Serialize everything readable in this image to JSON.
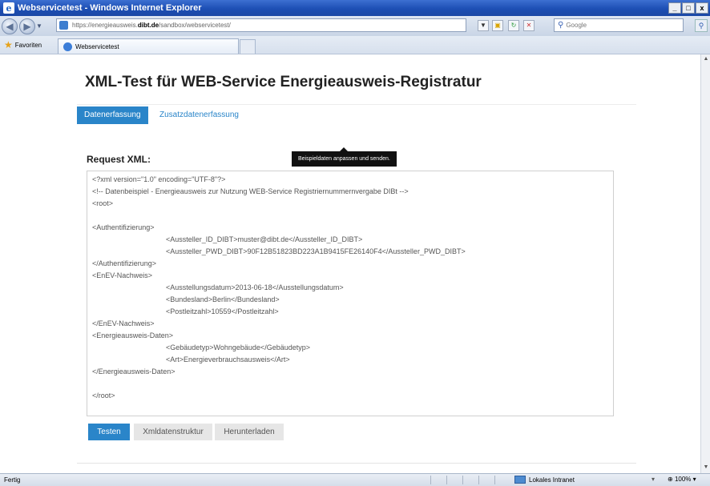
{
  "window": {
    "title": "Webservicetest - Windows Internet Explorer",
    "minimize": "_",
    "maximize": "□",
    "close": "x"
  },
  "address_bar": {
    "url_prefix": "https://energieausweis.",
    "url_domain": "dibt.de",
    "url_path": "/sandbox/webservicetest/",
    "search_placeholder": "Google"
  },
  "favorites_bar": {
    "label": "Favoriten",
    "tab_title": "Webservicetest"
  },
  "page": {
    "title": "XML-Test für WEB-Service Energieausweis-Registratur",
    "tabs": [
      {
        "label": "Datenerfassung",
        "active": true
      },
      {
        "label": "Zusatzdatenerfassung",
        "active": false
      }
    ],
    "request_label": "Request XML:",
    "tooltip": "Beispieldaten anpassen und senden.",
    "xml_lines": [
      "<?xml version=\"1.0\" encoding=\"UTF-8\"?>",
      "<!-- Datenbeispiel - Energieausweis zur Nutzung WEB-Service Registriernummernvergabe DIBt -->",
      "<root>",
      "",
      "<Authentifizierung>",
      "<Aussteller_ID_DIBT>muster@dibt.de</Aussteller_ID_DIBT>",
      "<Aussteller_PWD_DIBT>90F12B51823BD223A1B9415FE26140F4</Aussteller_PWD_DIBT>",
      "</Authentifizierung>",
      "<EnEV-Nachweis>",
      "<Ausstellungsdatum>2013-06-18</Ausstellungsdatum>",
      "<Bundesland>Berlin</Bundesland>",
      "<Postleitzahl>10559</Postleitzahl>",
      "</EnEV-Nachweis>",
      "<Energieausweis-Daten>",
      "<Gebäudetyp>Wohngebäude</Gebäudetyp>",
      "<Art>Energieverbrauchsausweis</Art>",
      "</Energieausweis-Daten>",
      "",
      "</root>"
    ],
    "buttons": {
      "test": "Testen",
      "xml_structure": "Xmldatenstruktur",
      "download": "Herunterladen"
    }
  },
  "status_bar": {
    "status": "Fertig",
    "zone": "Lokales Intranet",
    "zoom": "100%"
  },
  "colors": {
    "accent": "#2a85c9",
    "title_bar": "#1d4fb4"
  }
}
